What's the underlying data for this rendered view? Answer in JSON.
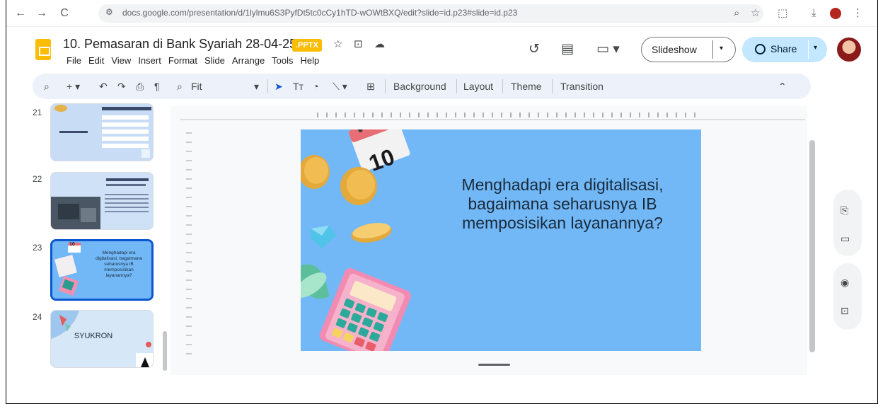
{
  "browser": {
    "url": "docs.google.com/presentation/d/1lylmu6S3PyfDt5tc0cCy1hTD-wOWtBXQ/edit?slide=id.p23#slide=id.p23"
  },
  "document": {
    "title": "10. Pemasaran di Bank Syariah 28-04-25",
    "file_badge": ".PPTX"
  },
  "menu": [
    "File",
    "Edit",
    "View",
    "Insert",
    "Format",
    "Slide",
    "Arrange",
    "Tools",
    "Help"
  ],
  "header": {
    "slideshow_label": "Slideshow",
    "share_label": "Share"
  },
  "toolbar": {
    "zoom_label": "Fit",
    "background_label": "Background",
    "layout_label": "Layout",
    "theme_label": "Theme",
    "transition_label": "Transition"
  },
  "filmstrip": {
    "slides": [
      {
        "number": "21"
      },
      {
        "number": "22"
      },
      {
        "number": "23",
        "text": "Menghadapi era digitalisasi, bagaimana seharusnya IB memposisikan layanannya?",
        "badge": "10"
      },
      {
        "number": "24",
        "text": "SYUKRON"
      }
    ]
  },
  "slide": {
    "text": "Menghadapi era digitalisasi, bagaimana seharusnya IB memposisikan layanannya?",
    "calendar_number": "10",
    "background_color": "#72b8f7"
  },
  "icons": {
    "back": "arrow-left-icon",
    "forward": "arrow-right-icon",
    "reload": "reload-icon",
    "star": "star-icon",
    "history": "history-icon",
    "comments": "comment-icon",
    "meet": "video-camera-icon"
  }
}
